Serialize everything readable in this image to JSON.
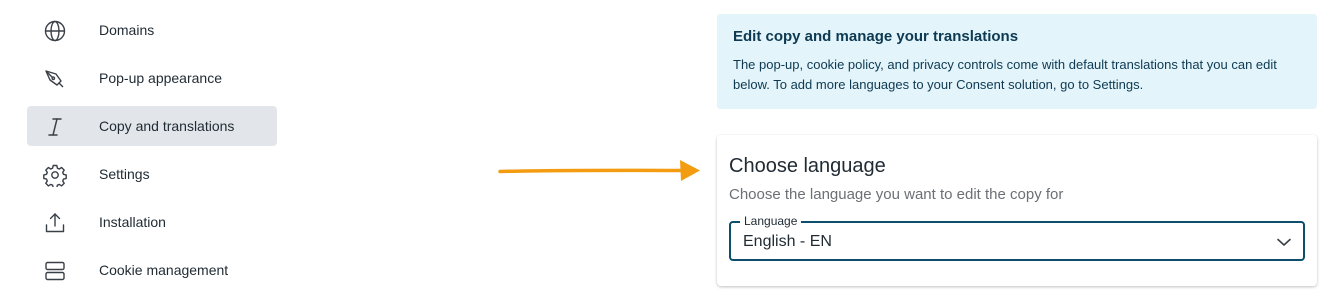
{
  "sidebar": {
    "items": [
      {
        "label": "Domains",
        "icon": "globe-icon"
      },
      {
        "label": "Pop-up appearance",
        "icon": "pen-nib-icon"
      },
      {
        "label": "Copy and translations",
        "icon": "italic-icon",
        "active": true
      },
      {
        "label": "Settings",
        "icon": "gear-icon"
      },
      {
        "label": "Installation",
        "icon": "upload-icon"
      },
      {
        "label": "Cookie management",
        "icon": "server-icon"
      }
    ]
  },
  "annotation": {
    "arrow_color": "#f39c12"
  },
  "info_banner": {
    "title": "Edit copy and manage your translations",
    "body": "The pop-up, cookie policy, and privacy controls come with default translations that you can edit below. To add more languages to your Consent solution, go to Settings."
  },
  "language_card": {
    "title": "Choose language",
    "subtitle": "Choose the language you want to edit the copy for",
    "select": {
      "label": "Language",
      "value": "English - EN"
    }
  },
  "colors": {
    "active_item_bg": "#e2e6ea",
    "banner_bg": "#e3f4fa",
    "banner_text": "#0d3a52",
    "select_border": "#0b4f6c"
  }
}
